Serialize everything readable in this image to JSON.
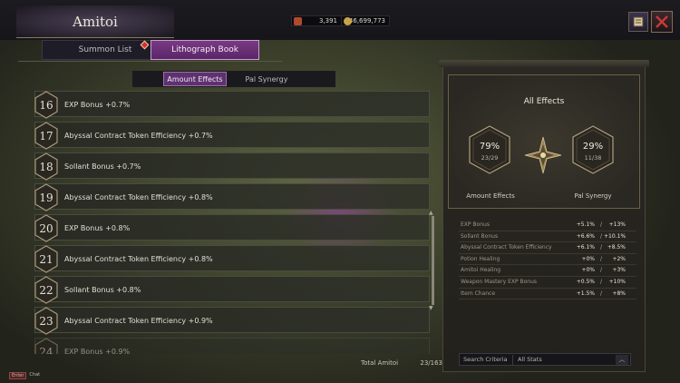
{
  "window": {
    "title": "Amitoi"
  },
  "currencies": [
    {
      "icon": "quill-icon",
      "value": "3,391"
    },
    {
      "icon": "gold-coin-icon",
      "value": "46,699,773"
    }
  ],
  "tabs": [
    {
      "label": "Summon List",
      "active": false
    },
    {
      "label": "Lithograph Book",
      "active": true
    }
  ],
  "subtabs": [
    {
      "label": "Amount Effects",
      "active": true
    },
    {
      "label": "Pal Synergy",
      "active": false
    }
  ],
  "list": [
    {
      "num": "16",
      "label": "EXP Bonus +0.7%"
    },
    {
      "num": "17",
      "label": "Abyssal Contract Token Efficiency +0.7%"
    },
    {
      "num": "18",
      "label": "Sollant Bonus +0.7%"
    },
    {
      "num": "19",
      "label": "Abyssal Contract Token Efficiency +0.8%"
    },
    {
      "num": "20",
      "label": "EXP Bonus +0.8%"
    },
    {
      "num": "21",
      "label": "Abyssal Contract Token Efficiency +0.8%"
    },
    {
      "num": "22",
      "label": "Sollant Bonus +0.8%"
    },
    {
      "num": "23",
      "label": "Abyssal Contract Token Efficiency +0.9%"
    },
    {
      "num": "24",
      "label": "EXP Bonus +0.9%"
    }
  ],
  "total": {
    "label": "Total Amitoi",
    "value": "23/163"
  },
  "chat": {
    "key": "Enter",
    "label": "Chat"
  },
  "summary": {
    "title": "All Effects",
    "amount": {
      "percent": "79%",
      "count": "23/29",
      "label": "Amount Effects"
    },
    "synergy": {
      "percent": "29%",
      "count": "11/38",
      "label": "Pal Synergy"
    },
    "effects": [
      {
        "name": "EXP Bonus",
        "amount": "+5.1%",
        "synergy": "+13%"
      },
      {
        "name": "Sollant Bonus",
        "amount": "+6.6%",
        "synergy": "+10.1%"
      },
      {
        "name": "Abyssal Contract Token Efficiency",
        "amount": "+6.1%",
        "synergy": "+8.5%"
      },
      {
        "name": "Potion Healing",
        "amount": "+0%",
        "synergy": "+2%"
      },
      {
        "name": "Amitoi Healing",
        "amount": "+0%",
        "synergy": "+3%"
      },
      {
        "name": "Weapon Mastery EXP Bonus",
        "amount": "+0.5%",
        "synergy": "+10%"
      },
      {
        "name": "Item Chance",
        "amount": "+1.5%",
        "synergy": "+8%"
      }
    ],
    "separator": "/"
  },
  "search": {
    "label": "Search Criteria",
    "value": "All Stats"
  },
  "colors": {
    "accent": "#5e3270",
    "tab_active": "#7a3a84",
    "badge_dot": "#d43030"
  }
}
